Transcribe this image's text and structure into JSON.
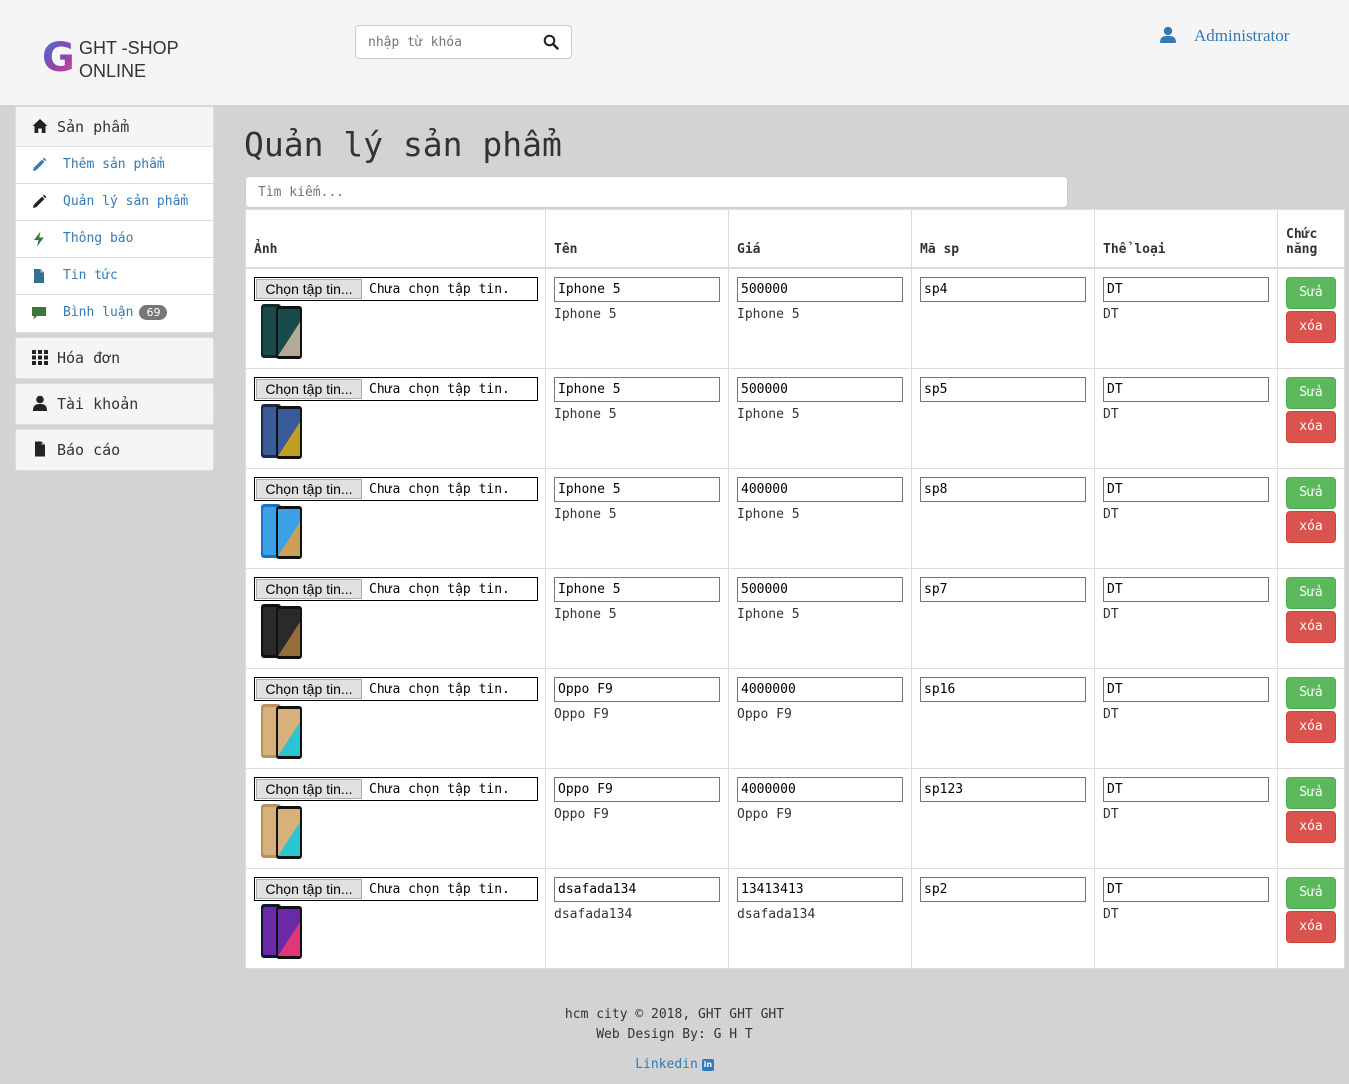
{
  "brand": {
    "logo_letter": "G",
    "line1": "GHT -SHOP",
    "line2": "ONLINE"
  },
  "header": {
    "search_placeholder": "nhập từ khóa",
    "user_name": "Administrator"
  },
  "sidebar": {
    "products": {
      "label": "Sản phẩm",
      "items": [
        {
          "label": "Thêm sản phẩm",
          "icon": "pencil-icon"
        },
        {
          "label": "Quản lý sản phẩm",
          "icon": "pencil-icon"
        },
        {
          "label": "Thông báo",
          "icon": "flash-icon"
        },
        {
          "label": "Tin tức",
          "icon": "file-icon"
        },
        {
          "label": "Bình luận",
          "icon": "comment-icon",
          "badge": "69"
        }
      ]
    },
    "invoices": {
      "label": "Hóa đơn"
    },
    "account": {
      "label": "Tài khoản"
    },
    "reports": {
      "label": "Báo cáo"
    }
  },
  "main": {
    "title": "Quản lý sản phẩm",
    "search_placeholder": "Tìm kiếm...",
    "columns": [
      "Ảnh",
      "Tên",
      "Giá",
      "Mã sp",
      "Thể loại",
      "Chức năng"
    ],
    "file_button": "Chọn tập tin...",
    "file_status": "Chưa chọn tập tin.",
    "edit_label": "Sửa",
    "delete_label": "xóa",
    "rows": [
      {
        "name_value": "Iphone 5",
        "name_text": "Iphone 5",
        "price_value": "500000",
        "price_text": "Iphone 5",
        "code_value": "sp4",
        "cat_value": "DT",
        "cat_text": "DT",
        "thumb": "phone-dark-green"
      },
      {
        "name_value": "Iphone 5",
        "name_text": "Iphone 5",
        "price_value": "500000",
        "price_text": "Iphone 5",
        "code_value": "sp5",
        "cat_value": "DT",
        "cat_text": "DT",
        "thumb": "phone-note-blue"
      },
      {
        "name_value": "Iphone 5",
        "name_text": "Iphone 5",
        "price_value": "400000",
        "price_text": "Iphone 5",
        "code_value": "sp8",
        "cat_value": "DT",
        "cat_text": "DT",
        "thumb": "phone-samsung-blue"
      },
      {
        "name_value": "Iphone 5",
        "name_text": "Iphone 5",
        "price_value": "500000",
        "price_text": "Iphone 5",
        "code_value": "sp7",
        "cat_value": "DT",
        "cat_text": "DT",
        "thumb": "phone-iphone-x"
      },
      {
        "name_value": "Oppo F9",
        "name_text": "Oppo F9",
        "price_value": "4000000",
        "price_text": "Oppo F9",
        "code_value": "sp16",
        "cat_value": "DT",
        "cat_text": "DT",
        "thumb": "phone-oppo-gold"
      },
      {
        "name_value": "Oppo F9",
        "name_text": "Oppo F9",
        "price_value": "4000000",
        "price_text": "Oppo F9",
        "code_value": "sp123",
        "cat_value": "DT",
        "cat_text": "DT",
        "thumb": "phone-oppo-gold"
      },
      {
        "name_value": "dsafada134",
        "name_text": "dsafada134",
        "price_value": "13413413",
        "price_text": "dsafada134",
        "code_value": "sp2",
        "cat_value": "DT",
        "cat_text": "DT",
        "thumb": "phone-galaxy-a70"
      }
    ]
  },
  "footer": {
    "line1": "hcm city © 2018, GHT GHT GHT",
    "line2": "Web Design By: G H T",
    "link": "Linkedin",
    "link_icon": "linkedin-icon"
  },
  "colors": {
    "primary": "#337ab7",
    "success": "#5cb85c",
    "danger": "#d9534f",
    "body_bg": "#d3d3d3",
    "header_bg": "#f5f5f5"
  }
}
